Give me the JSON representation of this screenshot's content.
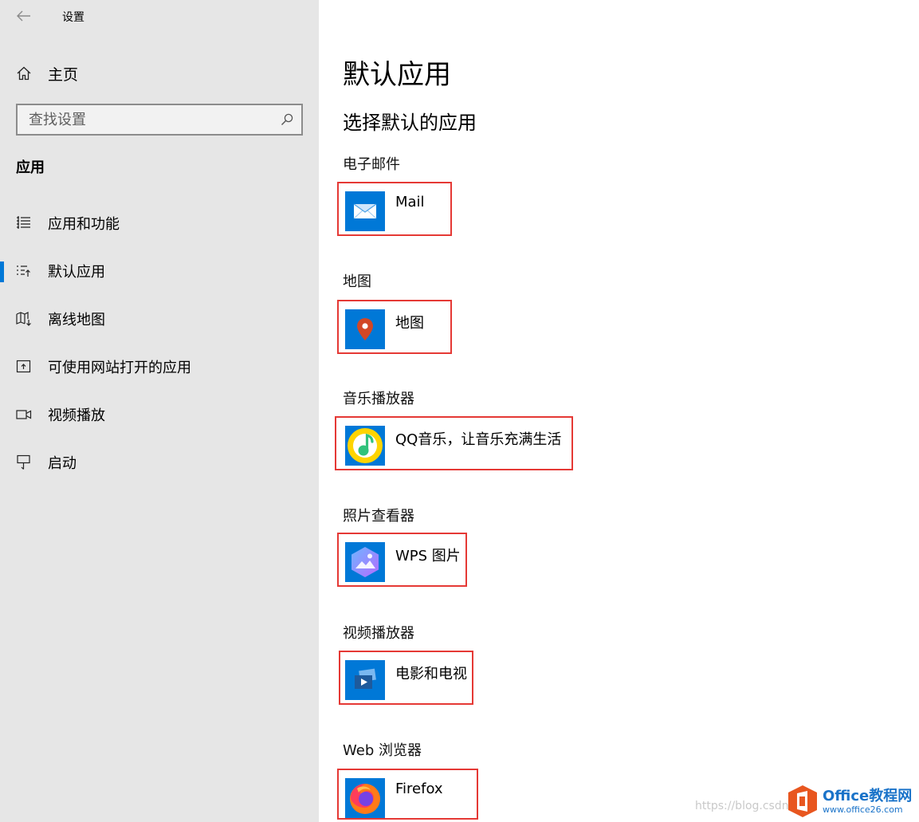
{
  "window": {
    "title": "设置"
  },
  "sidebar": {
    "home_label": "主页",
    "search_placeholder": "查找设置",
    "section_title": "应用",
    "items": [
      {
        "label": "应用和功能",
        "icon": "apps-features-icon",
        "active": false
      },
      {
        "label": "默认应用",
        "icon": "default-apps-icon",
        "active": true
      },
      {
        "label": "离线地图",
        "icon": "offline-maps-icon",
        "active": false
      },
      {
        "label": "可使用网站打开的应用",
        "icon": "apps-for-websites-icon",
        "active": false
      },
      {
        "label": "视频播放",
        "icon": "video-playback-icon",
        "active": false
      },
      {
        "label": "启动",
        "icon": "startup-icon",
        "active": false
      }
    ]
  },
  "main": {
    "title": "默认应用",
    "subtitle": "选择默认的应用",
    "categories": [
      {
        "label": "电子邮件",
        "app": "Mail",
        "icon": "mail-icon"
      },
      {
        "label": "地图",
        "app": "地图",
        "icon": "maps-icon"
      },
      {
        "label": "音乐播放器",
        "app": "QQ音乐，让音乐充满生活",
        "icon": "qq-music-icon"
      },
      {
        "label": "照片查看器",
        "app": "WPS 图片",
        "icon": "wps-photos-icon"
      },
      {
        "label": "视频播放器",
        "app": "电影和电视",
        "icon": "movies-tv-icon"
      },
      {
        "label": "Web 浏览器",
        "app": "Firefox",
        "icon": "firefox-icon"
      }
    ]
  },
  "watermark": {
    "csdn": "https://blog.csdn",
    "brand": "Office教程网",
    "url": "www.office26.com"
  },
  "colors": {
    "accent": "#0078d7",
    "highlight_border": "#e53935",
    "sidebar_bg": "#e6e6e6"
  }
}
